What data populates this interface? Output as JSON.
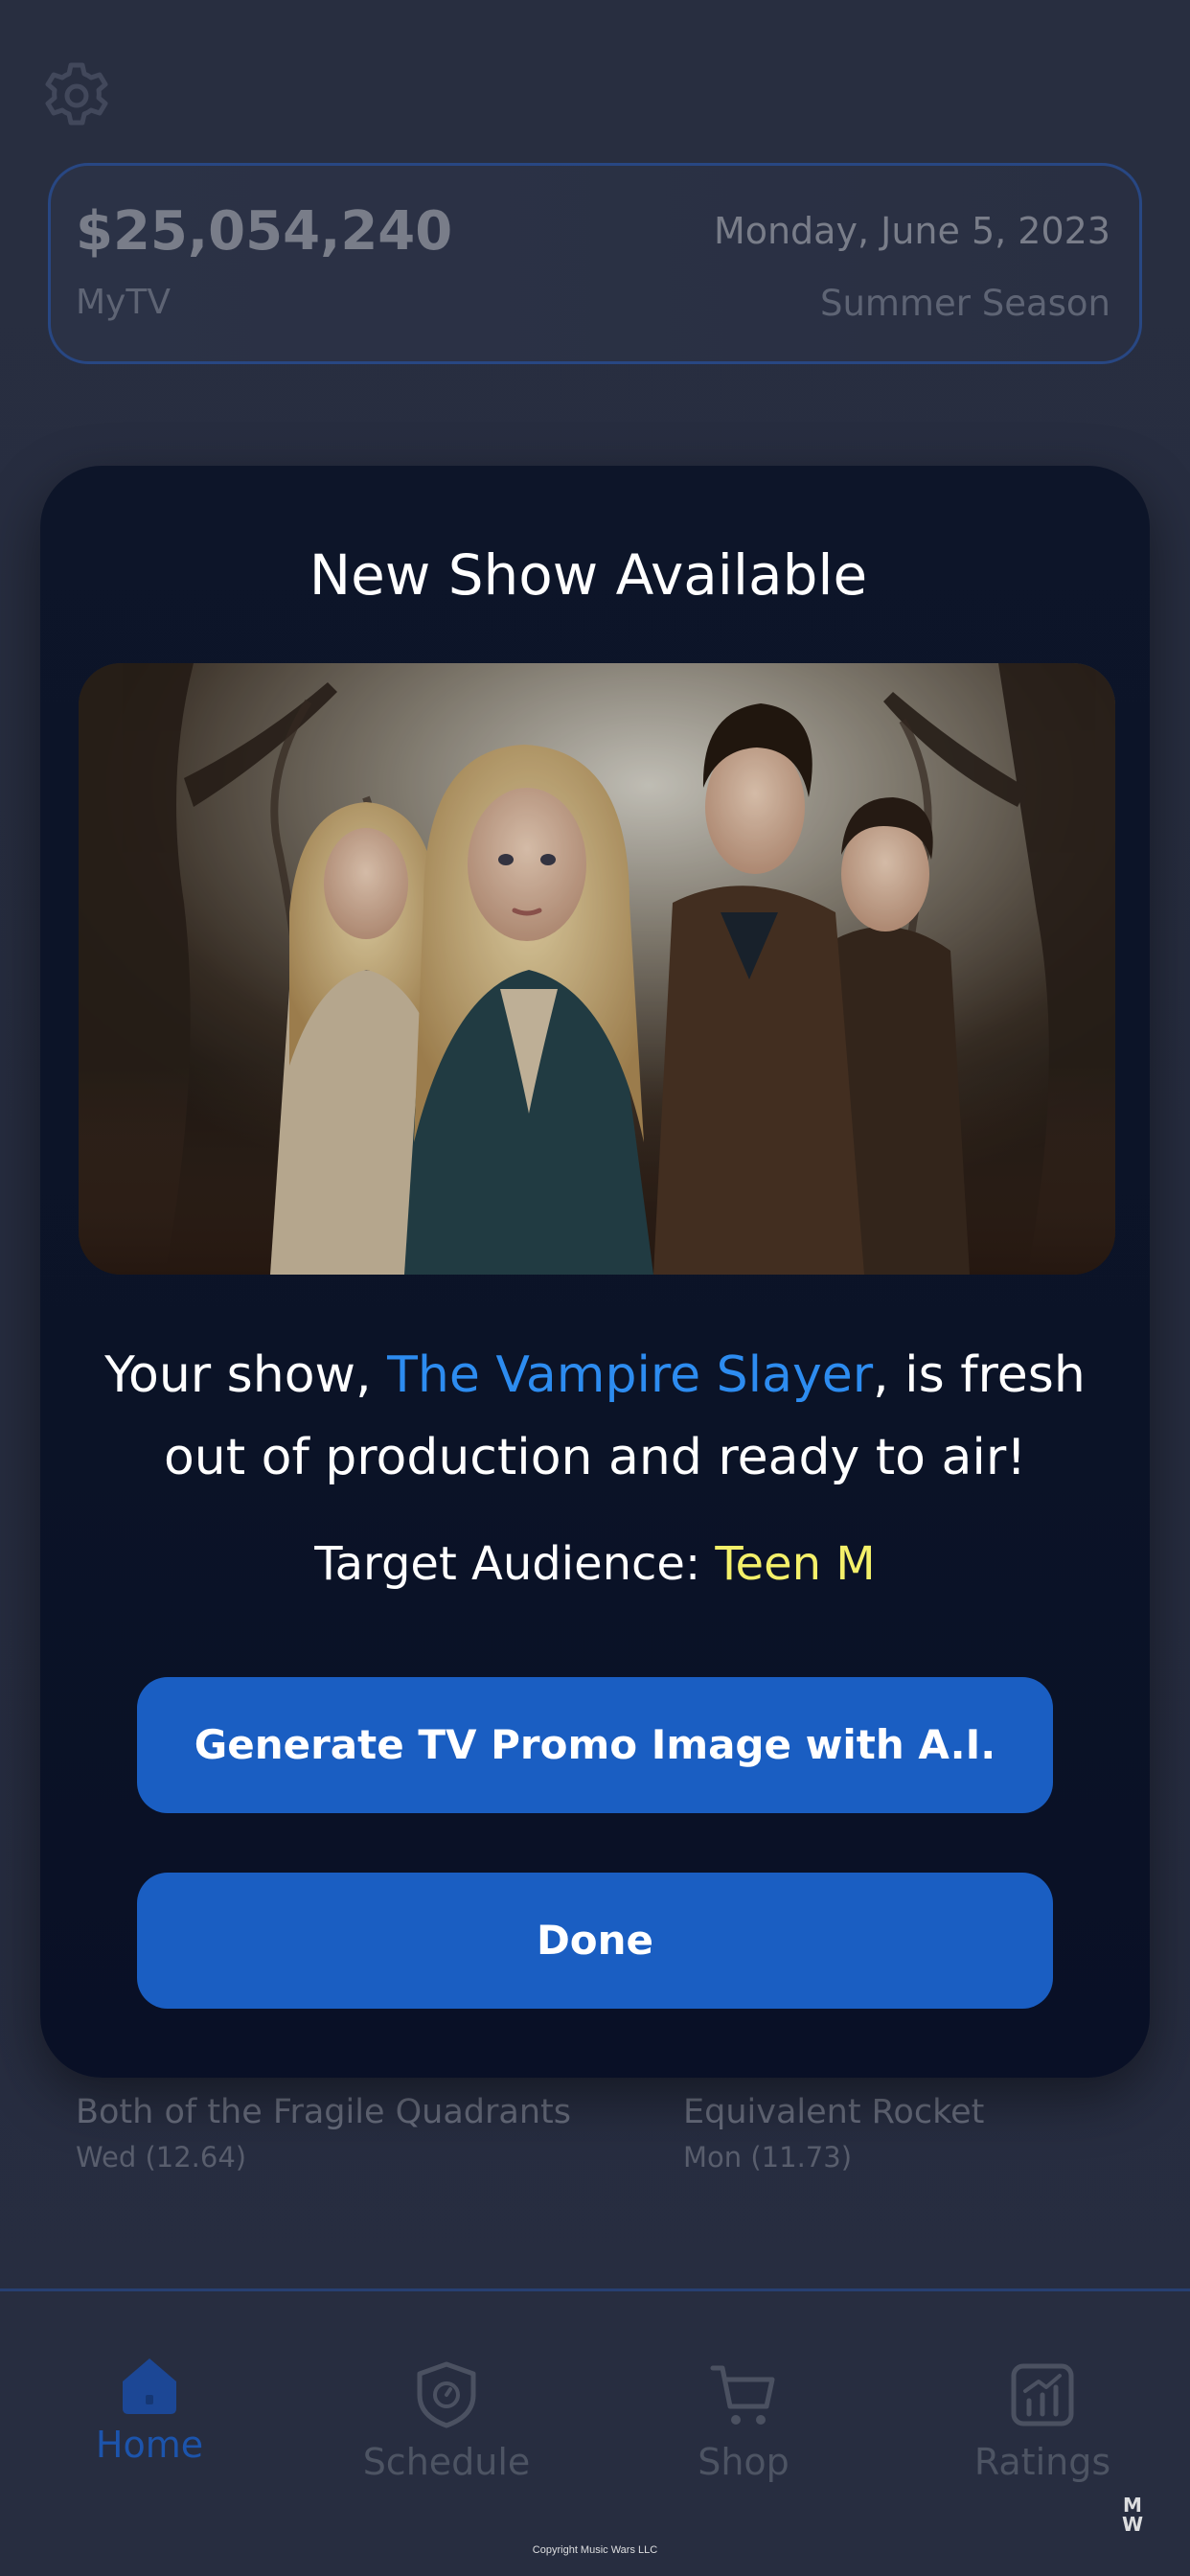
{
  "status_card": {
    "balance": "$25,054,240",
    "network": "MyTV",
    "date": "Monday, June 5, 2023",
    "season": "Summer Season",
    "border_color": "#2c4f93"
  },
  "shows": [
    {
      "title": "Both of the Fragile Quadrants",
      "subtitle": "Wed (12.64)"
    },
    {
      "title": "Equivalent Rocket",
      "subtitle": "Mon (11.73)"
    }
  ],
  "modal": {
    "title": "New Show Available",
    "image_alt": "Promo art: four characters in a dark misty forest",
    "message_prefix": "Your show, ",
    "show_name": "The Vampire Slayer",
    "message_suffix": ", is fresh out of production and ready to air!",
    "audience_label": "Target Audience: ",
    "audience_value": "Teen M",
    "generate_button": "Generate TV Promo Image with A.I.",
    "done_button": "Done",
    "colors": {
      "show_name": "#2d8cf0",
      "audience_value": "#f4f06a",
      "button": "#1a5ec2",
      "background": "#0b1327"
    }
  },
  "nav": {
    "items": [
      {
        "label": "Home",
        "icon": "home-icon",
        "active": true
      },
      {
        "label": "Schedule",
        "icon": "schedule-icon",
        "active": false
      },
      {
        "label": "Shop",
        "icon": "cart-icon",
        "active": false
      },
      {
        "label": "Ratings",
        "icon": "ratings-icon",
        "active": false
      }
    ],
    "active_color": "#1e5ec4"
  },
  "footer": {
    "copyright": "Copyright Music Wars LLC",
    "logo_text": "MW"
  }
}
